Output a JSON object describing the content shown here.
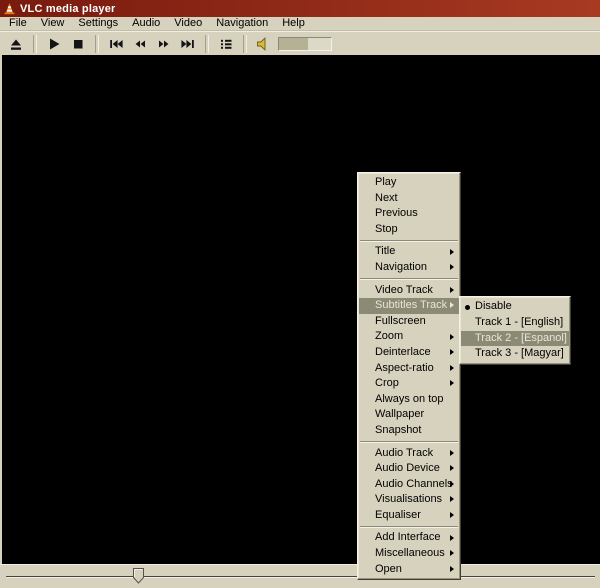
{
  "window": {
    "title": "VLC media player"
  },
  "menubar": {
    "items": [
      "File",
      "View",
      "Settings",
      "Audio",
      "Video",
      "Navigation",
      "Help"
    ]
  },
  "toolbar": {
    "groups": [
      [
        "eject"
      ],
      [
        "play",
        "stop"
      ],
      [
        "skip-back",
        "rewind",
        "fast-forward",
        "skip-forward"
      ],
      [
        "playlist"
      ],
      [
        "volume",
        "volume-slider"
      ]
    ],
    "volume_level_pct": 55
  },
  "context_menu": {
    "groups": [
      {
        "items": [
          {
            "label": "Play"
          },
          {
            "label": "Next"
          },
          {
            "label": "Previous"
          },
          {
            "label": "Stop"
          }
        ]
      },
      {
        "items": [
          {
            "label": "Title",
            "submenu": true
          },
          {
            "label": "Navigation",
            "submenu": true
          }
        ]
      },
      {
        "items": [
          {
            "label": "Video Track",
            "submenu": true
          },
          {
            "label": "Subtitles Track",
            "submenu": true,
            "highlighted": true
          },
          {
            "label": "Fullscreen"
          },
          {
            "label": "Zoom",
            "submenu": true
          },
          {
            "label": "Deinterlace",
            "submenu": true
          },
          {
            "label": "Aspect-ratio",
            "submenu": true
          },
          {
            "label": "Crop",
            "submenu": true
          },
          {
            "label": "Always on top"
          },
          {
            "label": "Wallpaper"
          },
          {
            "label": "Snapshot"
          }
        ]
      },
      {
        "items": [
          {
            "label": "Audio Track",
            "submenu": true
          },
          {
            "label": "Audio Device",
            "submenu": true
          },
          {
            "label": "Audio Channels",
            "submenu": true
          },
          {
            "label": "Visualisations",
            "submenu": true
          },
          {
            "label": "Equaliser",
            "submenu": true
          }
        ]
      },
      {
        "items": [
          {
            "label": "Add Interface",
            "submenu": true
          },
          {
            "label": "Miscellaneous",
            "submenu": true
          },
          {
            "label": "Open",
            "submenu": true
          }
        ]
      }
    ]
  },
  "subtitles_submenu": {
    "items": [
      {
        "label": "Disable",
        "selected": true
      },
      {
        "label": "Track 1 - [English]"
      },
      {
        "label": "Track 2 - [Espanol]",
        "highlighted": true
      },
      {
        "label": "Track 3 - [Magyar]"
      }
    ]
  },
  "seekbar": {
    "position_pct": 23
  },
  "colors": {
    "titlebar_left": "#781a0e",
    "titlebar_right": "#a83a22",
    "chrome_bg": "#d6d2bd",
    "menu_highlight": "#8b8a75",
    "menu_highlight_text": "#e9e6d4",
    "video_bg": "#000000",
    "speaker_gold": "#dcb93a"
  }
}
